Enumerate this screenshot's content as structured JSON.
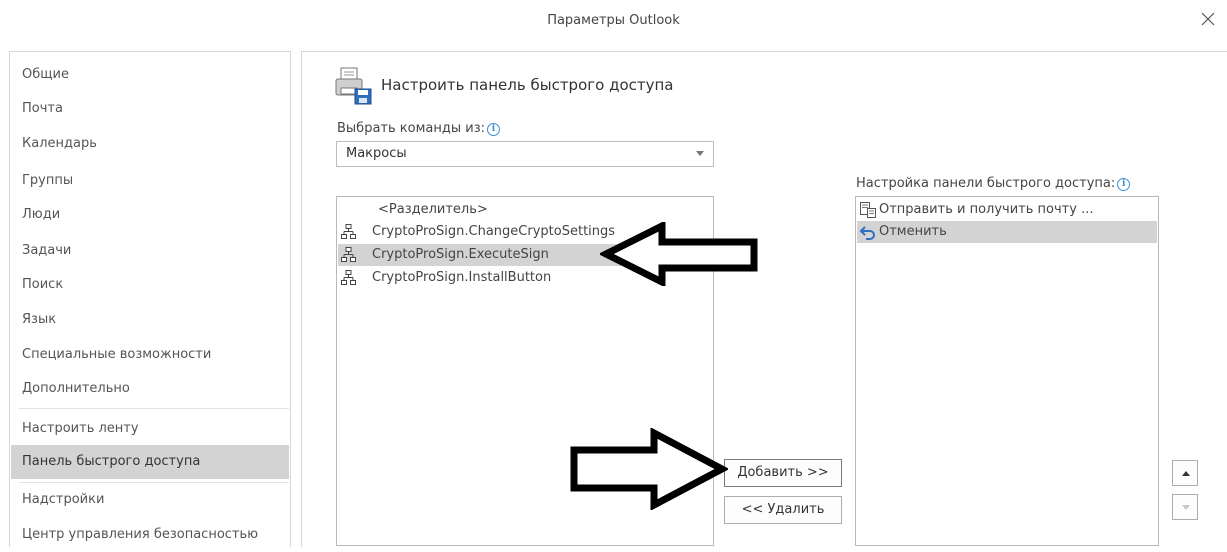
{
  "window": {
    "title": "Параметры Outlook"
  },
  "nav": {
    "items": [
      {
        "label": "Общие"
      },
      {
        "label": "Почта"
      },
      {
        "label": "Календарь"
      },
      {
        "label": "Группы"
      },
      {
        "label": "Люди"
      },
      {
        "label": "Задачи"
      },
      {
        "label": "Поиск"
      },
      {
        "label": "Язык"
      },
      {
        "label": "Специальные возможности"
      },
      {
        "label": "Дополнительно"
      },
      {
        "label": "Настроить ленту"
      },
      {
        "label": "Панель быстрого доступа",
        "selected": true
      },
      {
        "label": "Надстройки"
      },
      {
        "label": "Центр управления безопасностью"
      }
    ]
  },
  "main": {
    "header": "Настроить панель быстрого доступа",
    "choose_label": "Выбрать команды из:",
    "choose_value": "Макросы",
    "commands": [
      {
        "label": "<Разделитель>",
        "icon": null
      },
      {
        "label": "CryptoProSign.ChangeCryptoSettings",
        "icon": "macro-icon"
      },
      {
        "label": "CryptoProSign.ExecuteSign",
        "icon": "macro-icon",
        "selected": true
      },
      {
        "label": "CryptoProSign.InstallButton",
        "icon": "macro-icon"
      }
    ],
    "qat_label": "Настройка панели быстрого доступа:",
    "qat_items": [
      {
        "label": "Отправить и получить почту ...",
        "icon": "send-receive-icon"
      },
      {
        "label": "Отменить",
        "icon": "undo-icon",
        "selected": true
      }
    ],
    "add_button": "Добавить >>",
    "remove_button": "<< Удалить"
  },
  "colors": {
    "selection": "#d3d3d3",
    "info_blue": "#3d8fd8",
    "undo_blue": "#2f6fbf"
  }
}
